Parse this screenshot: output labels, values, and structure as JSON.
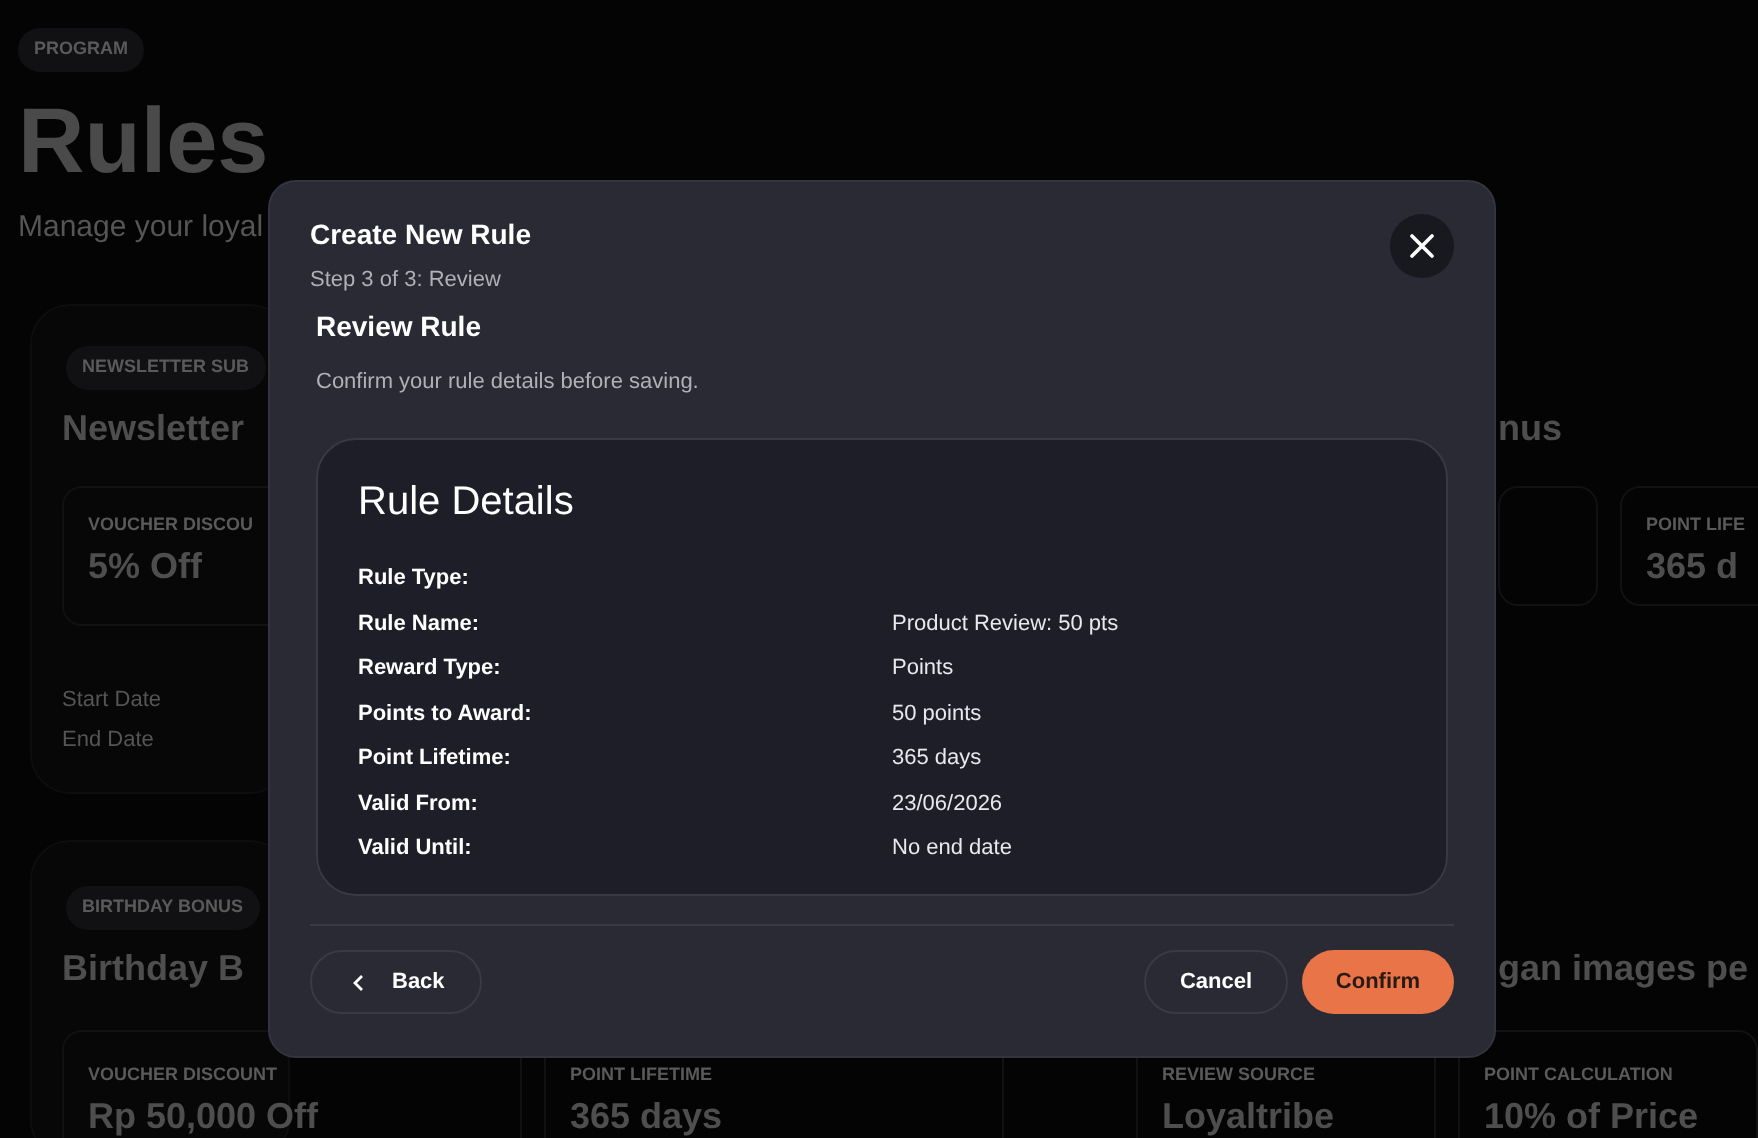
{
  "background": {
    "badge": "PROGRAM",
    "title": "Rules",
    "subtitle": "Manage your loyal",
    "cards": [
      {
        "badge": "NEWSLETTER SUB",
        "title": "Newsletter",
        "stat": {
          "label": "VOUCHER DISCOU",
          "value": "5% Off"
        },
        "dates": [
          "Start Date",
          "End Date"
        ]
      },
      {
        "badge": "BIRTHDAY BONUS",
        "title": "Birthday B",
        "stats": [
          {
            "label": "VOUCHER DISCOUNT",
            "value": "Rp 50,000 Off"
          },
          {
            "label": "POINT LIFETIME",
            "value": "365 days"
          }
        ]
      }
    ],
    "right": {
      "title_1": "nus",
      "stat_1": {
        "label": "POINT LIFE",
        "value": "365 d"
      },
      "title_2": "gan images pe",
      "stats_2": [
        {
          "label": "REVIEW SOURCE",
          "value": "Loyaltribe"
        },
        {
          "label": "POINT CALCULATION",
          "value": "10% of Price"
        }
      ]
    }
  },
  "dialog": {
    "title": "Create New Rule",
    "step": "Step 3 of 3: Review",
    "section_title": "Review Rule",
    "section_hint": "Confirm your rule details before saving.",
    "details": {
      "title": "Rule Details",
      "rows": [
        {
          "label": "Rule Type:"
        },
        {
          "label": "Rule Name:",
          "value": "Product Review: 50 pts"
        },
        {
          "label": "Reward Type:",
          "value": "Points"
        },
        {
          "label": "Points to Award:",
          "value": "50 points"
        },
        {
          "label": "Point Lifetime:",
          "value": "365 days"
        },
        {
          "label": "Valid From:",
          "value": "23/06/2026"
        },
        {
          "label": "Valid Until:",
          "value": "No end date"
        }
      ]
    },
    "buttons": {
      "back": "Back",
      "cancel": "Cancel",
      "confirm": "Confirm"
    }
  }
}
